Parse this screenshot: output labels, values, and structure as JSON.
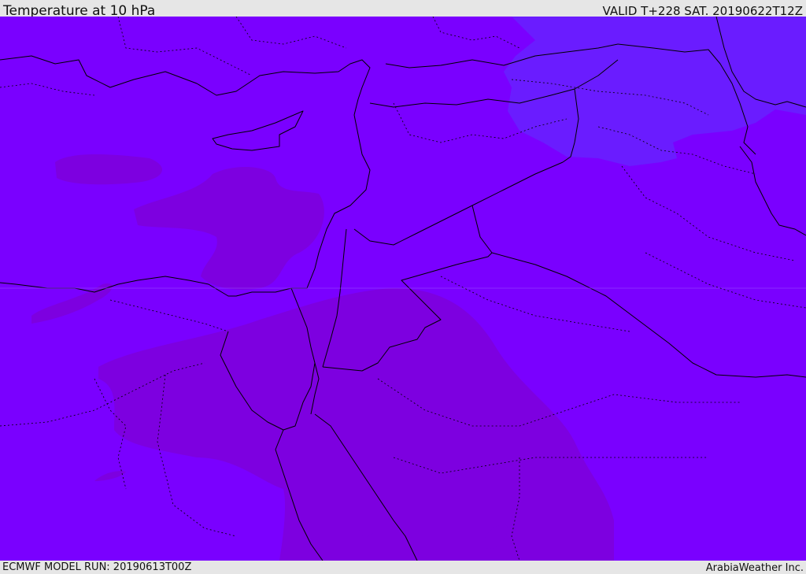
{
  "header": {
    "title": "Temperature at 10 hPa",
    "valid_time": "VALID T+228 SAT. 20190622T12Z"
  },
  "footer": {
    "model_run": "ECMWF MODEL RUN: 20190613T00Z",
    "credit": "ArabiaWeather Inc."
  },
  "map": {
    "colors": {
      "base": "#7a00ff",
      "warm_band": "#7d00e0",
      "cool_region": "#6a1cff",
      "border": "#000000"
    }
  }
}
